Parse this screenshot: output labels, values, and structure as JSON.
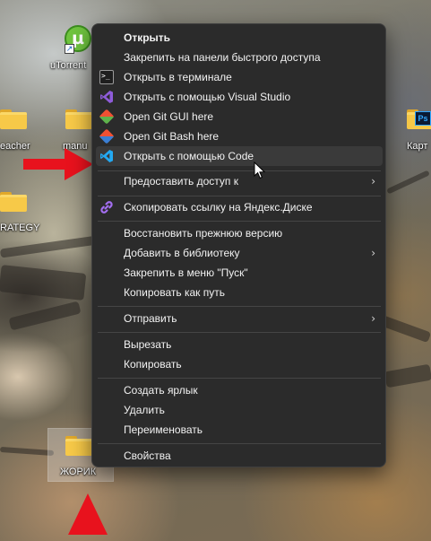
{
  "desktop": {
    "icons": [
      {
        "id": "utorrent",
        "label": "uTorrent"
      },
      {
        "id": "teacher",
        "label": "eacher"
      },
      {
        "id": "manu",
        "label": "manu"
      },
      {
        "id": "strategy",
        "label": "RATEGY"
      },
      {
        "id": "kart",
        "label": "Карт"
      },
      {
        "id": "zhorik",
        "label": "ЖОРИК"
      }
    ]
  },
  "context_menu": {
    "items": [
      {
        "label": "Открыть",
        "icon": "none",
        "bold": true
      },
      {
        "label": "Закрепить на панели быстрого доступа",
        "icon": "none"
      },
      {
        "label": "Открыть в терминале",
        "icon": "terminal-icon"
      },
      {
        "label": "Открыть с помощью Visual Studio",
        "icon": "visual-studio-icon"
      },
      {
        "label": "Open Git GUI here",
        "icon": "git-gui-icon"
      },
      {
        "label": "Open Git Bash here",
        "icon": "git-bash-icon"
      },
      {
        "label": "Открыть с помощью Code",
        "icon": "vscode-icon",
        "hover": true
      },
      {
        "label": "Предоставить доступ к",
        "icon": "none",
        "submenu": true
      },
      {
        "label": "Скопировать ссылку на Яндекс.Диске",
        "icon": "link-icon"
      },
      {
        "label": "Восстановить прежнюю версию",
        "icon": "none"
      },
      {
        "label": "Добавить в библиотеку",
        "icon": "none",
        "submenu": true
      },
      {
        "label": "Закрепить в меню \"Пуск\"",
        "icon": "none"
      },
      {
        "label": "Копировать как путь",
        "icon": "none"
      },
      {
        "label": "Отправить",
        "icon": "none",
        "submenu": true
      },
      {
        "label": "Вырезать",
        "icon": "none"
      },
      {
        "label": "Копировать",
        "icon": "none"
      },
      {
        "label": "Создать ярлык",
        "icon": "none"
      },
      {
        "label": "Удалить",
        "icon": "none"
      },
      {
        "label": "Переименовать",
        "icon": "none"
      },
      {
        "label": "Свойства",
        "icon": "none"
      }
    ],
    "chevron": "›"
  },
  "colors": {
    "menu_bg": "#2b2b2b",
    "menu_hover": "#3a3a3a",
    "accent_red": "#e8121d",
    "folder_yellow": "#f7c948",
    "vs_purple": "#8e5cd9",
    "vscode_blue": "#23a9f2",
    "git_orange": "#f05133"
  }
}
